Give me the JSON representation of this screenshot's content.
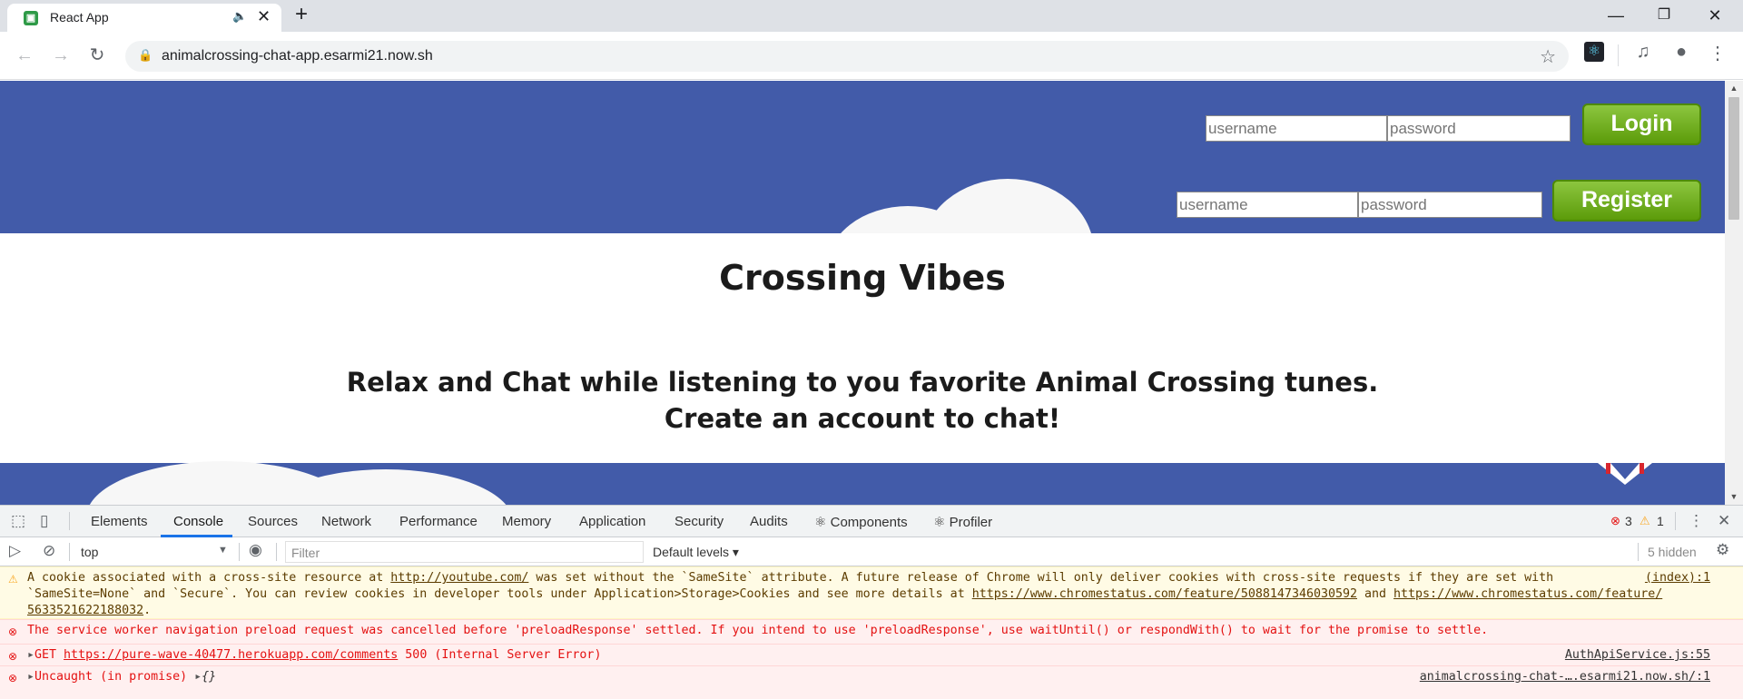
{
  "browser": {
    "tab_title": "React App",
    "url": "animalcrossing-chat-app.esarmi21.now.sh",
    "window_controls": [
      "minimize-icon",
      "restore-icon",
      "close-icon"
    ]
  },
  "page": {
    "login": {
      "username_placeholder": "username",
      "password_placeholder": "password",
      "button": "Login"
    },
    "register": {
      "username_placeholder": "username",
      "password_placeholder": "password",
      "button": "Register"
    },
    "title": "Crossing Vibes",
    "subtitle_line1": "Relax and Chat while listening to you favorite Animal Crossing tunes.",
    "subtitle_line2": "Create an account to chat!",
    "colors": {
      "header_bg": "#425ba9",
      "button_green": "#6fb01f"
    }
  },
  "devtools": {
    "tabs": [
      "Elements",
      "Console",
      "Sources",
      "Network",
      "Performance",
      "Memory",
      "Application",
      "Security",
      "Audits",
      "⚛ Components",
      "⚛ Profiler"
    ],
    "active_tab": "Console",
    "error_count": "3",
    "warning_count": "1",
    "context": "top",
    "filter_placeholder": "Filter",
    "levels": "Default levels",
    "hidden": "5 hidden",
    "messages": {
      "warning": {
        "line1_a": "A cookie associated with a cross-site resource at ",
        "line1_link": "http://youtube.com/",
        "line1_b": " was set without the `SameSite` attribute. A future release of Chrome will only deliver cookies with cross-site requests if they are set with",
        "line2_a": "`SameSite=None` and `Secure`. You can review cookies in developer tools under Application>Storage>Cookies and see more details at ",
        "line2_link1": "https://www.chromestatus.com/feature/5088147346030592",
        "line2_b": " and ",
        "line2_link2": "https://www.chromestatus.com/feature/",
        "line3_link": "5633521622188032",
        "line3_b": ".",
        "source": "(index):1"
      },
      "error1": {
        "text": "The service worker navigation preload request was cancelled before 'preloadResponse' settled. If you intend to use 'preloadResponse', use waitUntil() or respondWith() to wait for the promise to settle."
      },
      "error2": {
        "method": "GET ",
        "url": "https://pure-wave-40477.herokuapp.com/comments",
        "status": " 500 (Internal Server Error)",
        "source": "AuthApiService.js:55"
      },
      "error3": {
        "text": "Uncaught (in promise) ",
        "obj": "{}",
        "source": "animalcrossing-chat-….esarmi21.now.sh/:1"
      }
    }
  }
}
